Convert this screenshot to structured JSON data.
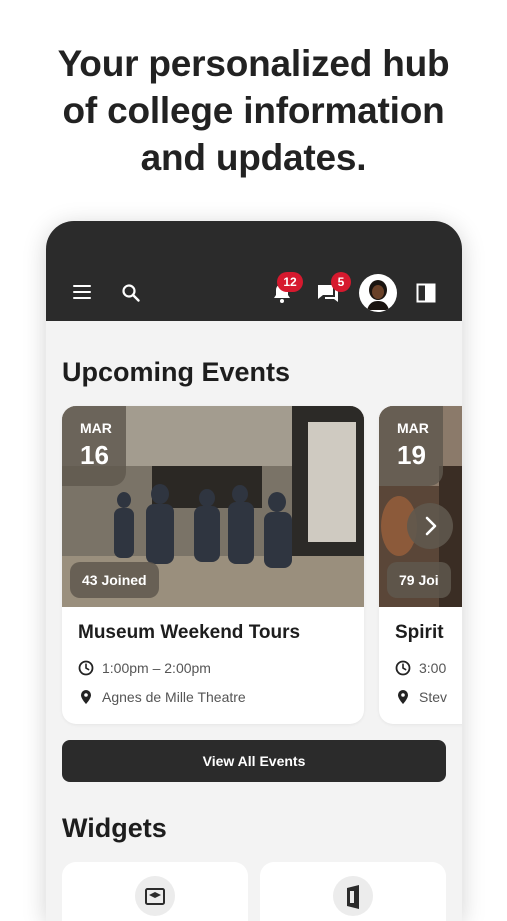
{
  "headline": {
    "line1": "Your personalized hub",
    "line2": "of college information",
    "line3": "and updates."
  },
  "appbar": {
    "background": "#2b2b2b",
    "icons": [
      "menu-icon",
      "search-icon",
      "bell-icon",
      "chat-icon",
      "avatar",
      "panel-icon"
    ],
    "notifications_count": "12",
    "messages_count": "5",
    "badge_color": "#d6192e"
  },
  "events": {
    "section_title": "Upcoming Events",
    "cards": [
      {
        "month": "MAR",
        "day": "16",
        "joined": "43 Joined",
        "title": "Museum Weekend Tours",
        "time": "1:00pm – 2:00pm",
        "location": "Agnes de Mille Theatre"
      },
      {
        "month": "MAR",
        "day": "19",
        "joined": "79 Joi",
        "title": "Spirit",
        "time": "3:00",
        "location": "Stev"
      }
    ],
    "view_all_label": "View All Events"
  },
  "widgets": {
    "section_title": "Widgets",
    "items": [
      {
        "icon": "graduation-cap-icon"
      },
      {
        "icon": "office-icon"
      }
    ]
  }
}
